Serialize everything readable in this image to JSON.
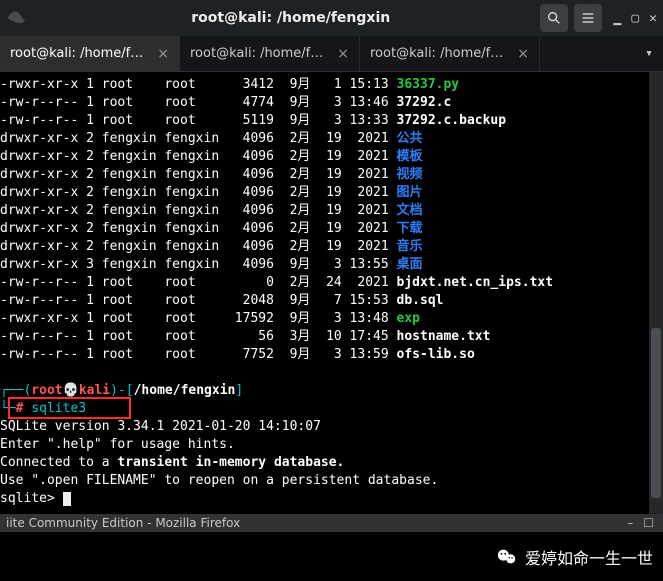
{
  "window": {
    "title": "root@kali: /home/fengxin"
  },
  "tabs": [
    {
      "label": "root@kali: /home/fe...",
      "active": true
    },
    {
      "label": "root@kali: /home/fe...",
      "active": false
    },
    {
      "label": "root@kali: /home/fe...",
      "active": false
    }
  ],
  "listing": [
    {
      "perm": "-rwxr-xr-x",
      "n": "1",
      "u": "root   ",
      "g": "root   ",
      "size": "  3412",
      "date": " 9月   1 15:13",
      "name": "36337.py",
      "color": "gr"
    },
    {
      "perm": "-rw-r--r--",
      "n": "1",
      "u": "root   ",
      "g": "root   ",
      "size": "  4774",
      "date": " 9月   3 13:46",
      "name": "37292.c",
      "color": "w"
    },
    {
      "perm": "-rw-r--r--",
      "n": "1",
      "u": "root   ",
      "g": "root   ",
      "size": "  5119",
      "date": " 9月   3 13:33",
      "name": "37292.c.backup",
      "color": "w"
    },
    {
      "perm": "drwxr-xr-x",
      "n": "2",
      "u": "fengxin",
      "g": "fengxin",
      "size": "  4096",
      "date": " 2月  19  2021",
      "name": "公共",
      "color": "bl"
    },
    {
      "perm": "drwxr-xr-x",
      "n": "2",
      "u": "fengxin",
      "g": "fengxin",
      "size": "  4096",
      "date": " 2月  19  2021",
      "name": "模板",
      "color": "bl"
    },
    {
      "perm": "drwxr-xr-x",
      "n": "2",
      "u": "fengxin",
      "g": "fengxin",
      "size": "  4096",
      "date": " 2月  19  2021",
      "name": "视频",
      "color": "bl"
    },
    {
      "perm": "drwxr-xr-x",
      "n": "2",
      "u": "fengxin",
      "g": "fengxin",
      "size": "  4096",
      "date": " 2月  19  2021",
      "name": "图片",
      "color": "bl"
    },
    {
      "perm": "drwxr-xr-x",
      "n": "2",
      "u": "fengxin",
      "g": "fengxin",
      "size": "  4096",
      "date": " 2月  19  2021",
      "name": "文档",
      "color": "bl"
    },
    {
      "perm": "drwxr-xr-x",
      "n": "2",
      "u": "fengxin",
      "g": "fengxin",
      "size": "  4096",
      "date": " 2月  19  2021",
      "name": "下载",
      "color": "bl"
    },
    {
      "perm": "drwxr-xr-x",
      "n": "2",
      "u": "fengxin",
      "g": "fengxin",
      "size": "  4096",
      "date": " 2月  19  2021",
      "name": "音乐",
      "color": "bl"
    },
    {
      "perm": "drwxr-xr-x",
      "n": "3",
      "u": "fengxin",
      "g": "fengxin",
      "size": "  4096",
      "date": " 9月   3 13:55",
      "name": "桌面",
      "color": "bl"
    },
    {
      "perm": "-rw-r--r--",
      "n": "1",
      "u": "root   ",
      "g": "root   ",
      "size": "     0",
      "date": " 2月  24  2021",
      "name": "bjdxt.net.cn_ips.txt",
      "color": "w"
    },
    {
      "perm": "-rw-r--r--",
      "n": "1",
      "u": "root   ",
      "g": "root   ",
      "size": "  2048",
      "date": " 9月   7 15:53",
      "name": "db.sql",
      "color": "w"
    },
    {
      "perm": "-rwxr-xr-x",
      "n": "1",
      "u": "root   ",
      "g": "root   ",
      "size": " 17592",
      "date": " 9月   3 13:48",
      "name": "exp",
      "color": "gr"
    },
    {
      "perm": "-rw-r--r--",
      "n": "1",
      "u": "root   ",
      "g": "root   ",
      "size": "    56",
      "date": " 3月  10 17:45",
      "name": "hostname.txt",
      "color": "w"
    },
    {
      "perm": "-rw-r--r--",
      "n": "1",
      "u": "root   ",
      "g": "root   ",
      "size": "  7752",
      "date": " 9月   3 13:59",
      "name": "ofs-lib.so",
      "color": "w"
    }
  ],
  "prompt": {
    "open": "┌──(",
    "user": "root",
    "at": "💀",
    "host": "kali",
    "close1": ")-[",
    "path": "/home/fengxin",
    "close2": "]",
    "line2open": "└─",
    "hash": "#",
    "command": "sqlite3"
  },
  "sqlite": {
    "l1": "SQLite version 3.34.1 2021-01-20 14:10:07",
    "l2": "Enter \".help\" for usage hints.",
    "l3a": "Connected to a ",
    "l3b": "transient in-memory database.",
    "l4": "Use \".open FILENAME\" to reopen on a persistent database.",
    "prompt": "sqlite> "
  },
  "firefox_strip": "iite Community Edition - Mozilla Firefox",
  "watermark": "爱婷如命一生一世"
}
